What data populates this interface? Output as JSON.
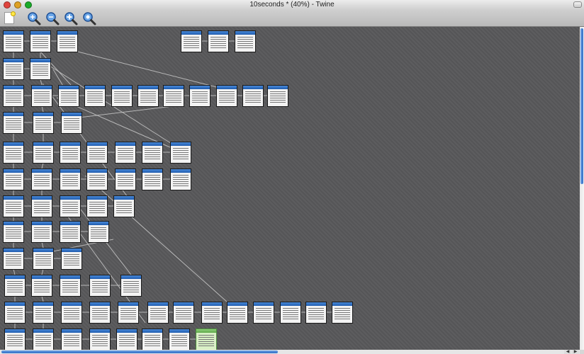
{
  "window": {
    "title": "10seconds * (40%) - Twine"
  },
  "toolbar": {
    "buttons": [
      {
        "name": "new-passage-button",
        "icon": "new-passage-icon"
      },
      {
        "name": "zoom-in-button",
        "icon": "zoom-in-icon",
        "symbol": "+"
      },
      {
        "name": "zoom-out-button",
        "icon": "zoom-out-icon",
        "symbol": "−"
      },
      {
        "name": "zoom-fit-button",
        "icon": "zoom-fit-icon",
        "symbol": "+"
      },
      {
        "name": "zoom-actual-button",
        "icon": "zoom-actual-icon",
        "symbol": ""
      }
    ]
  },
  "story_map": {
    "background": "#58585a",
    "passage_header_color": "#2f6fc4",
    "selected_color": "#8fd07a",
    "passage_count": 89,
    "selected_passage": "Row 12, passage 8"
  }
}
